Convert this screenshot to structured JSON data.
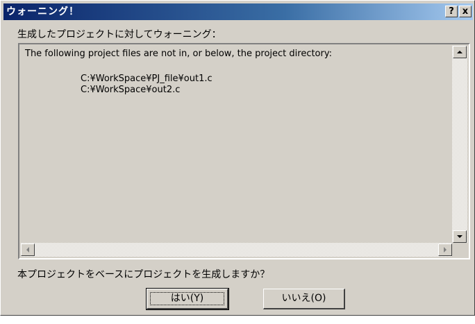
{
  "window": {
    "title": "ウォーニング！",
    "help_label": "?",
    "close_label": "x"
  },
  "message": {
    "header": "生成したプロジェクトに対してウォーニング：",
    "lines": [
      "The following project files are not in, or below, the project directory:",
      "C:¥WorkSpace¥PJ_file¥out1.c",
      "C:¥WorkSpace¥out2.c"
    ]
  },
  "prompt": "本プロジェクトをベースにプロジェクトを生成しますか？",
  "buttons": {
    "yes_label": "はい(Y)",
    "no_label": "いいえ(O)"
  },
  "colors": {
    "face": "#d4d0c8",
    "title_start": "#0a246a",
    "title_end": "#a6caf0"
  }
}
